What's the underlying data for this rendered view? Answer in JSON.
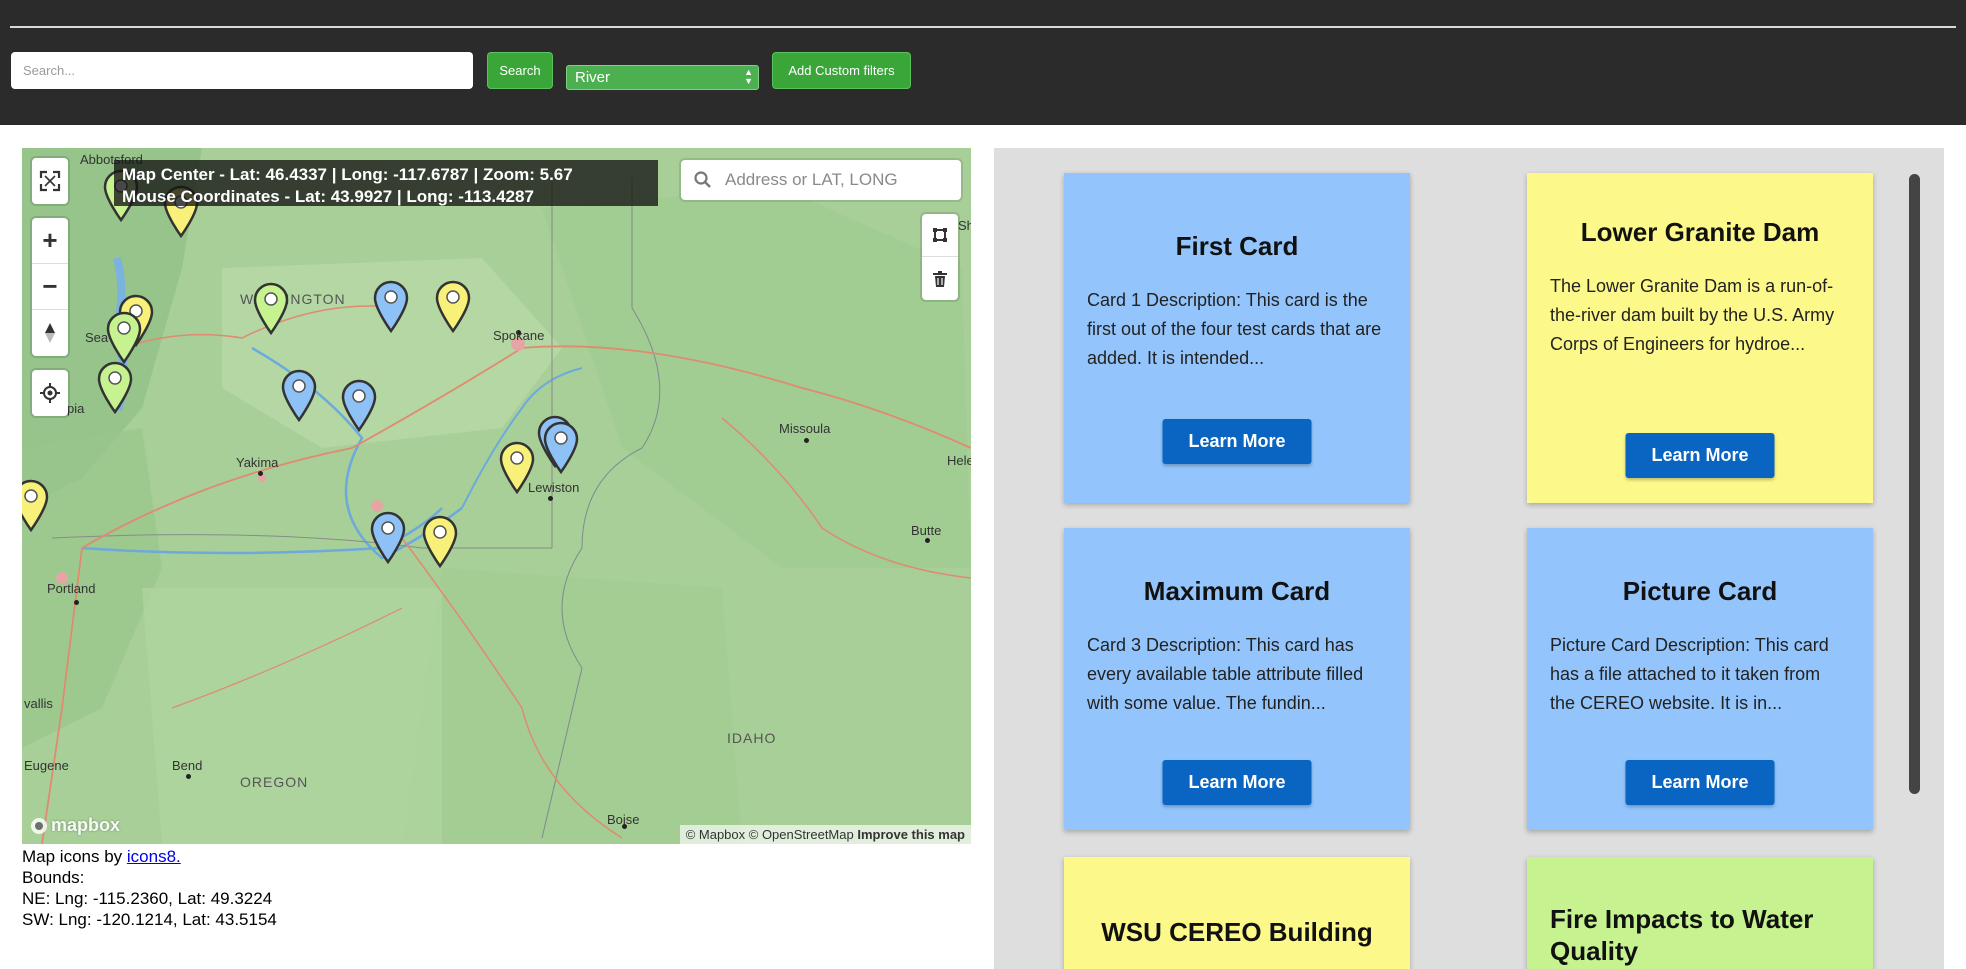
{
  "toolbar": {
    "search_placeholder": "Search...",
    "search_button": "Search",
    "filter_select": "River",
    "custom_filters_button": "Add Custom filters"
  },
  "map": {
    "info_center": "Map Center - Lat: 46.4337 | Long: -117.6787 | Zoom: 5.67",
    "info_mouse": "Mouse Coordinates - Lat: 43.9927 | Long: -113.4287",
    "geocoder_placeholder": "Address or LAT, LONG",
    "labels": {
      "abbotsford": "Abbotsford",
      "washington": "WASHINGTON",
      "seattle": "Sea",
      "olympia": "pia",
      "spokane": "Spokane",
      "missoula": "Missoula",
      "yakima": "Yakima",
      "lewiston": "Lewiston",
      "helena": "Hele",
      "butte": "Butte",
      "portland": "Portland",
      "corvallis": "vallis",
      "eugene": "Eugene",
      "bend": "Bend",
      "oregon": "OREGON",
      "idaho": "IDAHO",
      "boise": "Boise",
      "edge_sh": "Sh"
    },
    "logo_text": "mapbox",
    "attribution": "© Mapbox © OpenStreetMap",
    "improve": "Improve this map",
    "pin_colors": {
      "blue": "#8ec1f5",
      "yellow": "#f7f17a",
      "green": "#c6f28f"
    }
  },
  "below_map": {
    "icons_prefix": "Map icons by ",
    "icons_link": "icons8.",
    "bounds_label": "Bounds:",
    "ne": "NE: Lng: -115.2360, Lat: 49.3224",
    "sw": "SW: Lng: -120.1214, Lat: 43.5154"
  },
  "cards": [
    {
      "title": "First Card",
      "description": "Card 1 Description: This card is the first out of the four test cards that are added. It is intended...",
      "button": "Learn More",
      "color": "#93c5fc"
    },
    {
      "title": "Lower Granite Dam",
      "description": "The Lower Granite Dam is a run-of-the-river dam built by the U.S. Army Corps of Engineers for hydroe...",
      "button": "Learn More",
      "color": "#fcf98a"
    },
    {
      "title": "Maximum Card",
      "description": "Card 3 Description: This card has every available table attribute filled with some value. The fundin...",
      "button": "Learn More",
      "color": "#93c5fc"
    },
    {
      "title": "Picture Card",
      "description": "Picture Card Description: This card has a file attached to it taken from the CEREO website. It is in...",
      "button": "Learn More",
      "color": "#93c5fc"
    },
    {
      "title": "WSU CEREO Building",
      "color": "#fcf98a"
    },
    {
      "title": "Fire Impacts to Water Quality",
      "color": "#c6f28f"
    }
  ]
}
